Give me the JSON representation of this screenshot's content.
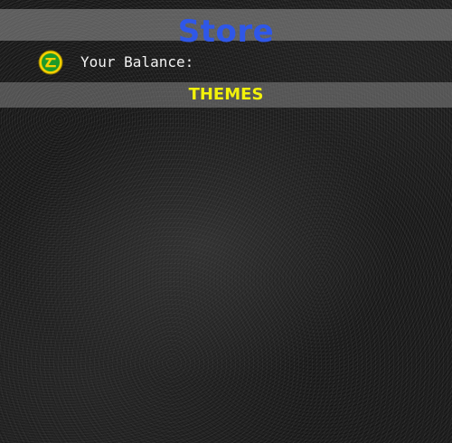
{
  "header": {
    "title": "Store"
  },
  "balance": {
    "label": "Your Balance:",
    "icon": "coin-icon"
  },
  "tab": {
    "label": "THEMES"
  },
  "colors": {
    "title": "#2f57e8",
    "tab_label": "#f2f20a",
    "coin_outer": "#f5d000",
    "coin_inner": "#1d9a2a",
    "label_text": "#f2f2f2"
  }
}
